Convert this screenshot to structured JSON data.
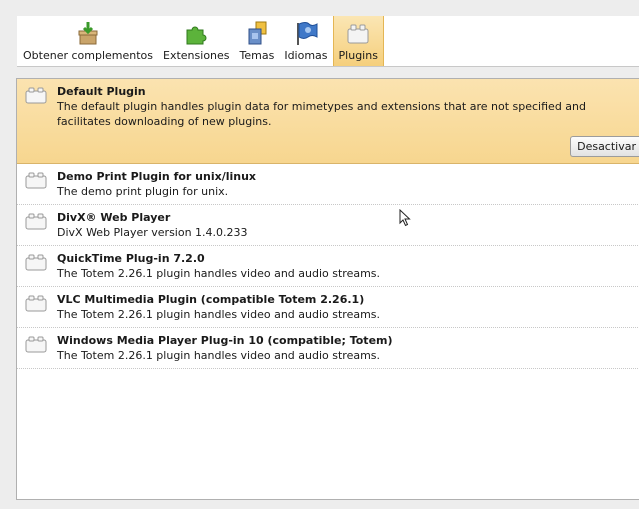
{
  "toolbar": {
    "items": [
      {
        "label": "Obtener complementos",
        "icon": "get-addons-icon"
      },
      {
        "label": "Extensiones",
        "icon": "puzzle-piece-icon"
      },
      {
        "label": "Temas",
        "icon": "themes-icon"
      },
      {
        "label": "Idiomas",
        "icon": "language-flag-icon"
      },
      {
        "label": "Plugins",
        "icon": "plugin-brick-icon",
        "selected": true
      }
    ]
  },
  "plugins": [
    {
      "name": "Default Plugin",
      "description": "The default plugin handles plugin data for mimetypes and extensions that are not specified and facilitates downloading of new plugins.",
      "selected": true,
      "action_label": "Desactivar"
    },
    {
      "name": "Demo Print Plugin for unix/linux",
      "description": "The demo print plugin for unix."
    },
    {
      "name": "DivX® Web Player",
      "description": "DivX Web Player version 1.4.0.233"
    },
    {
      "name": "QuickTime Plug-in 7.2.0",
      "description": "The  Totem  2.26.1 plugin handles video and audio streams."
    },
    {
      "name": "VLC Multimedia Plugin (compatible Totem 2.26.1)",
      "description": "The  Totem  2.26.1 plugin handles video and audio streams."
    },
    {
      "name": "Windows Media Player Plug-in 10 (compatible; Totem)",
      "description": "The  Totem  2.26.1 plugin handles video and audio streams."
    }
  ],
  "colors": {
    "selection": "#f7d68f",
    "toolbar_bg": "#ffffff",
    "window_bg": "#ededed"
  }
}
